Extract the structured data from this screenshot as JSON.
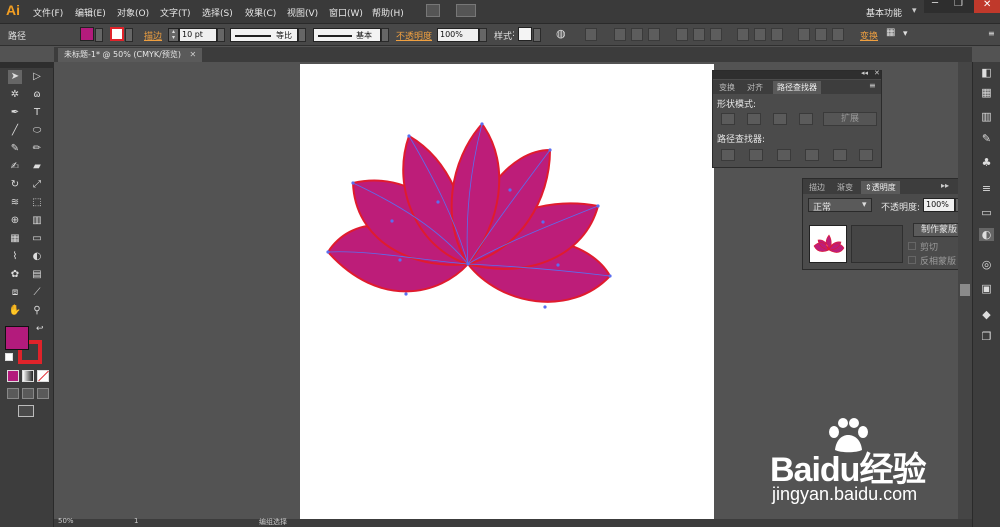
{
  "app": {
    "logo": "Ai",
    "workspace": "基本功能"
  },
  "menu": [
    "文件(F)",
    "编辑(E)",
    "对象(O)",
    "文字(T)",
    "选择(S)",
    "效果(C)",
    "视图(V)",
    "窗口(W)",
    "帮助(H)"
  ],
  "options": {
    "selection_type": "路径",
    "stroke_label": "描边",
    "stroke_weight": "10 pt",
    "profile_label": "等比",
    "brush_label": "基本",
    "opacity_label": "不透明度",
    "opacity_value": "100%",
    "style_label": "样式",
    "transform_label": "变换",
    "fill_color": "#b31b7c",
    "stroke_color": "#e0232a"
  },
  "document": {
    "tab_title": "未标题-1* @ 50% (CMYK/预览)"
  },
  "pathfinder_panel": {
    "tabs": [
      "变换",
      "对齐",
      "路径查找器"
    ],
    "shape_modes_label": "形状模式:",
    "expand_button": "扩展",
    "pathfinders_label": "路径查找器:"
  },
  "transparency_panel": {
    "tabs": [
      "描边",
      "渐变",
      "透明度"
    ],
    "blend_mode": "正常",
    "opacity_label": "不透明度:",
    "opacity_value": "100%",
    "make_mask_button": "制作蒙版",
    "clip_label": "剪切",
    "invert_mask_label": "反相蒙版"
  },
  "statusbar": {
    "zoom": "50%",
    "page": "1",
    "tool_status": "编组选择"
  },
  "watermark": {
    "brand": "Baidu经验",
    "url": "jingyan.baidu.com"
  },
  "colors": {
    "petal_fill": "#bd1d79",
    "petal_stroke": "#e01b2e",
    "path_line": "#5a6ef0"
  }
}
